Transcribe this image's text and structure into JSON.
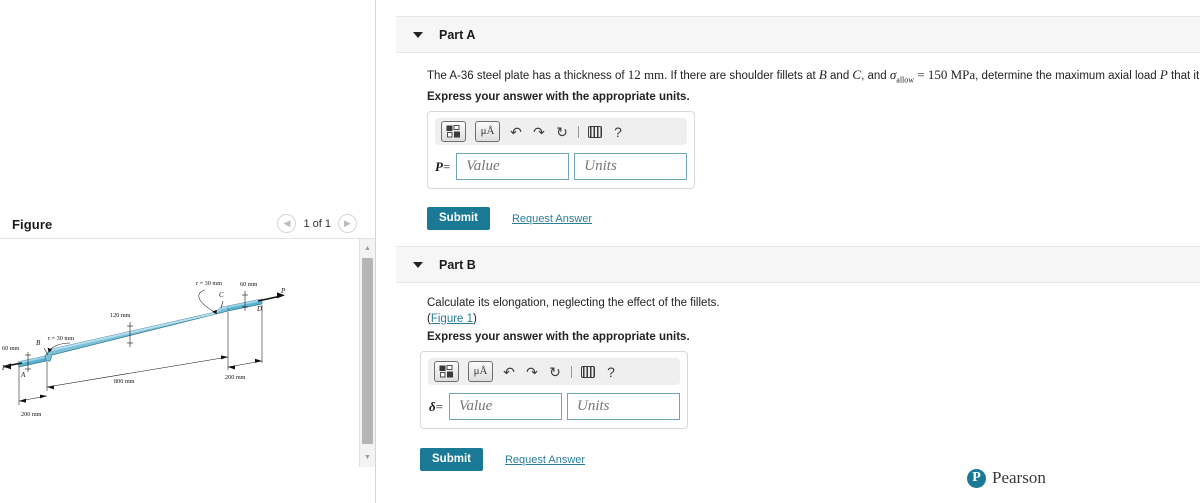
{
  "figure_panel": {
    "title": "Figure",
    "pager": {
      "prev_icon": "chevron-left-icon",
      "next_icon": "chevron-right-icon",
      "label": "1 of 1"
    },
    "diagram": {
      "labels": {
        "r_left": "r = 30 mm",
        "r_right": "r = 30 mm",
        "width_mid": "120 mm",
        "width_left": "60 mm",
        "width_right": "60 mm",
        "len_left": "200 mm",
        "len_mid": "800 mm",
        "len_right": "200 mm",
        "point_a": "A",
        "point_b": "B",
        "point_c": "C",
        "point_d": "D",
        "load_left": "P",
        "load_right": "P"
      },
      "plate_color": "#7cbfd9",
      "plate_edge_color": "#3f86a5"
    }
  },
  "parts": [
    {
      "id": "part-a",
      "title": "Part A",
      "question_prefix": "The A-36 steel plate has a thickness of ",
      "question_q1": "12",
      "question_unit1": "mm",
      "question_mid1": ". If there are shoulder fillets at ",
      "question_varB": "B",
      "question_mid2": " and ",
      "question_varC": "C",
      "question_mid3": ", and ",
      "question_sigma": "σallow",
      "question_eq": " = ",
      "question_q2": "150",
      "question_unit2": "MPa",
      "question_mid4": ", determine the maximum axial load ",
      "question_varP": "P",
      "question_suffix": " that it can support.",
      "instruction": "Express your answer with the appropriate units.",
      "answer_label": "P",
      "answer_equals": "=",
      "value_placeholder": "Value",
      "units_placeholder": "Units",
      "submit_label": "Submit",
      "request_answer_label": "Request Answer",
      "toolbar": {
        "template_icon": "math-template-icon",
        "units_icon": "micro-angstrom-icon",
        "units_text": "μÅ",
        "undo_icon": "undo-arrow-icon",
        "redo_icon": "redo-arrow-icon",
        "reset_icon": "reset-circular-arrow-icon",
        "keyboard_icon": "keyboard-icon",
        "help_icon": "help-question-icon",
        "help_text": "?"
      }
    },
    {
      "id": "part-b",
      "title": "Part B",
      "question_line": "Calculate its elongation, neglecting the effect of the fillets.",
      "figure_link": "Figure 1",
      "instruction": "Express your answer with the appropriate units.",
      "answer_label": "δ",
      "answer_equals": "=",
      "value_placeholder": "Value",
      "units_placeholder": "Units",
      "submit_label": "Submit",
      "request_answer_label": "Request Answer",
      "toolbar": {
        "template_icon": "math-template-icon",
        "units_icon": "micro-angstrom-icon",
        "units_text": "μÅ",
        "undo_icon": "undo-arrow-icon",
        "redo_icon": "redo-arrow-icon",
        "reset_icon": "reset-circular-arrow-icon",
        "keyboard_icon": "keyboard-icon",
        "help_icon": "help-question-icon",
        "help_text": "?"
      }
    }
  ],
  "branding": {
    "mark": "P",
    "name": "Pearson",
    "color": "#1a7a95"
  },
  "theme": {
    "accent": "#1a7a95",
    "link": "#2a7d9b",
    "field_border": "#6fa5bb",
    "header_bg": "#f6f6f6"
  }
}
